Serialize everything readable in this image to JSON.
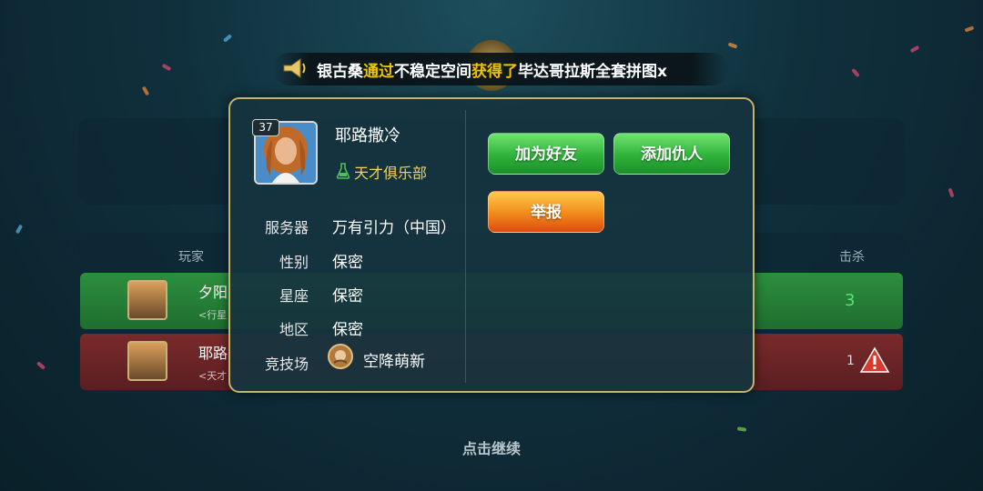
{
  "announcement": {
    "parts": [
      {
        "text": "银古桑",
        "highlight": false
      },
      {
        "text": "通过",
        "highlight": true
      },
      {
        "text": "不稳定空间",
        "highlight": false
      },
      {
        "text": "获得了",
        "highlight": true
      },
      {
        "text": "毕达哥拉斯全套拼图x",
        "highlight": false
      }
    ]
  },
  "profile": {
    "level": "37",
    "name": "耶路撒冷",
    "club": "天才俱乐部",
    "info": [
      {
        "label": "服务器",
        "value": "万有引力（中国）"
      },
      {
        "label": "性别",
        "value": "保密"
      },
      {
        "label": "星座",
        "value": "保密"
      },
      {
        "label": "地区",
        "value": "保密"
      }
    ],
    "arena": {
      "label": "竞技场",
      "value": "空降萌新"
    }
  },
  "buttons": {
    "add_friend": "加为好友",
    "add_enemy": "添加仇人",
    "report": "举报"
  },
  "scoreboard": {
    "headers": {
      "player": "玩家",
      "kills": "击杀"
    },
    "rows": [
      {
        "name": "夕阳",
        "sub": "<行星",
        "kills": "3"
      },
      {
        "name": "耶路",
        "sub": "<天才",
        "kills": "1"
      }
    ]
  },
  "continue_text": "点击继续",
  "colors": {
    "accent_gold": "#f0c400",
    "button_green": "#2fb23a",
    "button_orange": "#f08a1a",
    "popup_border": "#c4b46a"
  }
}
